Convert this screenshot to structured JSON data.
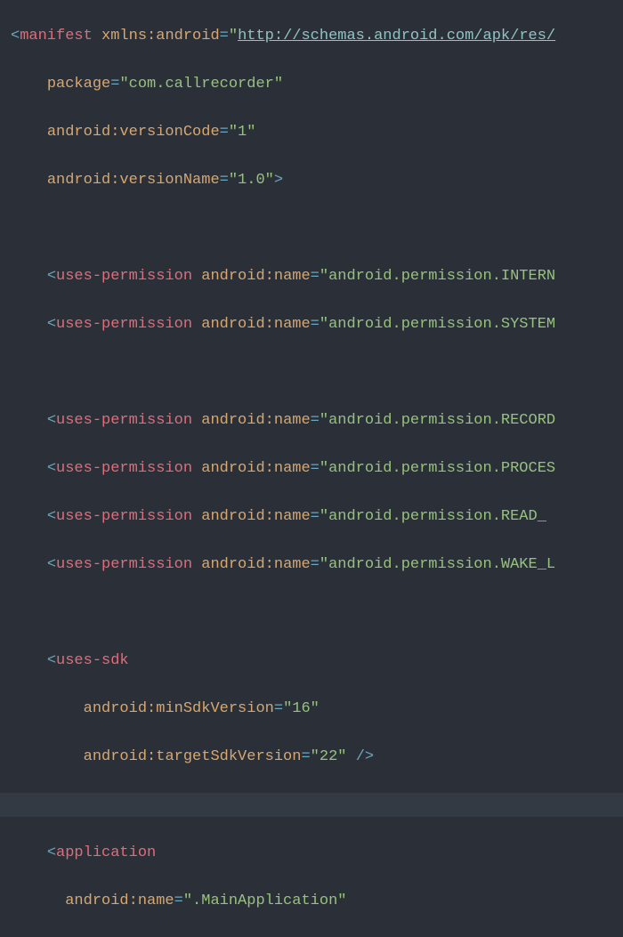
{
  "lines": {
    "l1": {
      "indent": "",
      "open": "<",
      "tag": "manifest",
      "sp": " ",
      "attr": "xmlns:android",
      "eq": "=",
      "q1": "\"",
      "url": "http://schemas.android.com/apk/res/",
      "q2": ""
    },
    "l2": {
      "indent": "    ",
      "attr": "package",
      "eq": "=",
      "val": "\"com.callrecorder\""
    },
    "l3": {
      "indent": "    ",
      "attr": "android:versionCode",
      "eq": "=",
      "val": "\"1\""
    },
    "l4": {
      "indent": "    ",
      "attr": "android:versionName",
      "eq": "=",
      "val": "\"1.0\"",
      "close": ">"
    },
    "l5": {
      "indent": ""
    },
    "l6": {
      "indent": "    ",
      "open": "<",
      "tag": "uses-permission",
      "sp": " ",
      "attr": "android:name",
      "eq": "=",
      "val": "\"android.permission.INTERN"
    },
    "l7": {
      "indent": "    ",
      "open": "<",
      "tag": "uses-permission",
      "sp": " ",
      "attr": "android:name",
      "eq": "=",
      "val": "\"android.permission.SYSTEM"
    },
    "l8": {
      "indent": ""
    },
    "l9": {
      "indent": "    ",
      "open": "<",
      "tag": "uses-permission",
      "sp": " ",
      "attr": "android:name",
      "eq": "=",
      "val": "\"android.permission.RECORD"
    },
    "l10": {
      "indent": "    ",
      "open": "<",
      "tag": "uses-permission",
      "sp": " ",
      "attr": "android:name",
      "eq": "=",
      "val": "\"android.permission.PROCES"
    },
    "l11": {
      "indent": "    ",
      "open": "<",
      "tag": "uses-permission",
      "sp": " ",
      "attr": "android:name",
      "eq": "=",
      "val": "\"android.permission.READ_"
    },
    "l12": {
      "indent": "    ",
      "open": "<",
      "tag": "uses-permission",
      "sp": " ",
      "attr": "android:name",
      "eq": "=",
      "val": "\"android.permission.WAKE_L"
    },
    "l13": {
      "indent": ""
    },
    "l14": {
      "indent": "    ",
      "open": "<",
      "tag": "uses-sdk"
    },
    "l15": {
      "indent": "        ",
      "attr": "android:minSdkVersion",
      "eq": "=",
      "val": "\"16\""
    },
    "l16": {
      "indent": "        ",
      "attr": "android:targetSdkVersion",
      "eq": "=",
      "val": "\"22\"",
      "sp": " ",
      "close": "/>"
    },
    "l17": {
      "indent": ""
    },
    "l18": {
      "indent": "    ",
      "open": "<",
      "tag": "application"
    },
    "l19": {
      "indent": "      ",
      "attr": "android:name",
      "eq": "=",
      "val": "\".MainApplication\""
    }
  }
}
